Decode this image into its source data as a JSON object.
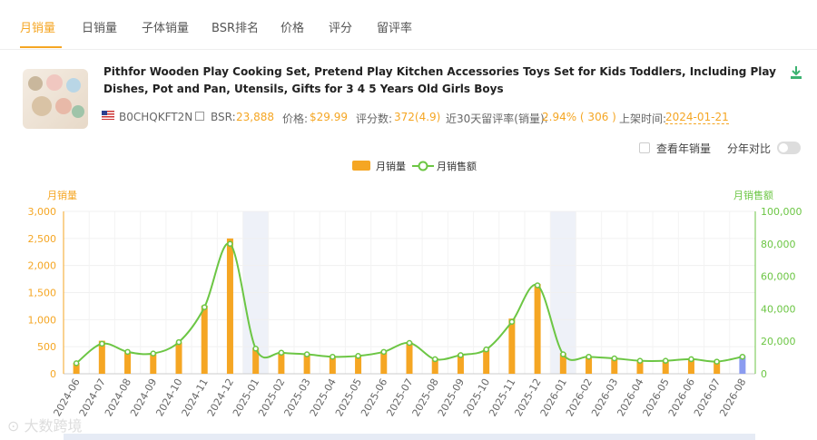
{
  "tabs": [
    "月销量",
    "日销量",
    "子体销量",
    "BSR排名",
    "价格",
    "评分",
    "留评率"
  ],
  "active_tab": 0,
  "product": {
    "title": "Pithfor Wooden Play Cooking Set, Pretend Play Kitchen Accessories Toys Set for Kids Toddlers, Including Play Dishes, Pot and Pan, Utensils, Gifts for 3 4 5 Years Old Girls Boys",
    "asin": "B0CHQKFT2N",
    "bsr_label": "BSR:",
    "bsr_value": "23,888",
    "price_label": "价格:",
    "price_value": "$29.99",
    "rating_label": "评分数:",
    "rating_value": "372(4.9)",
    "review_rate_label": "近30天留评率(销量):",
    "review_rate_value": "2.94% ( 306 )",
    "listed_label": "上架时间:",
    "listed_value": "2024-01-21"
  },
  "options": {
    "year_sales_label": "查看年销量",
    "yoy_label": "分年对比"
  },
  "legend": {
    "bar_label": "月销量",
    "line_label": "月销售额"
  },
  "watermark": "大数跨境",
  "colors": {
    "accent": "#f5a623",
    "line": "#6cc644",
    "highlight_bar": "#8b9cf0",
    "band": "#eef1f8"
  },
  "chart_data": {
    "type": "bar",
    "left_axis_title": "月销量",
    "right_axis_title": "月销售额",
    "categories": [
      "2024-06",
      "2024-07",
      "2024-08",
      "2024-09",
      "2024-10",
      "2024-11",
      "2024-12",
      "2025-01",
      "2025-02",
      "2025-03",
      "2025-04",
      "2025-05",
      "2025-06",
      "2025-07",
      "2025-08",
      "2025-09",
      "2025-10",
      "2025-11",
      "2025-12",
      "2026-01",
      "2026-02",
      "2026-03",
      "2026-04",
      "2026-05",
      "2026-06",
      "2026-07",
      "2026-08"
    ],
    "series": [
      {
        "name": "月销量",
        "type": "bar",
        "axis": "left",
        "values": [
          200,
          610,
          410,
          380,
          580,
          1260,
          2500,
          480,
          390,
          370,
          330,
          330,
          420,
          590,
          290,
          370,
          460,
          1020,
          1660,
          380,
          320,
          300,
          250,
          250,
          280,
          230,
          330
        ]
      },
      {
        "name": "月销售额",
        "type": "line",
        "axis": "right",
        "values": [
          6500,
          18500,
          13500,
          12500,
          19500,
          41000,
          80000,
          15500,
          13000,
          12000,
          10500,
          11000,
          13500,
          19000,
          9000,
          11500,
          15000,
          32000,
          54500,
          12000,
          10500,
          9500,
          8000,
          8000,
          9000,
          7500,
          10500
        ]
      }
    ],
    "ylim_left": [
      0,
      3000
    ],
    "yticks_left": [
      "0",
      "500",
      "1,000",
      "1,500",
      "2,000",
      "2,500",
      "3,000"
    ],
    "ylim_right": [
      0,
      100000
    ],
    "yticks_right": [
      "0",
      "20,000",
      "40,000",
      "60,000",
      "80,000",
      "100,000"
    ],
    "highlight_bands": [
      "2025-01",
      "2026-01"
    ],
    "highlight_bar": "2026-08",
    "grid": true
  }
}
